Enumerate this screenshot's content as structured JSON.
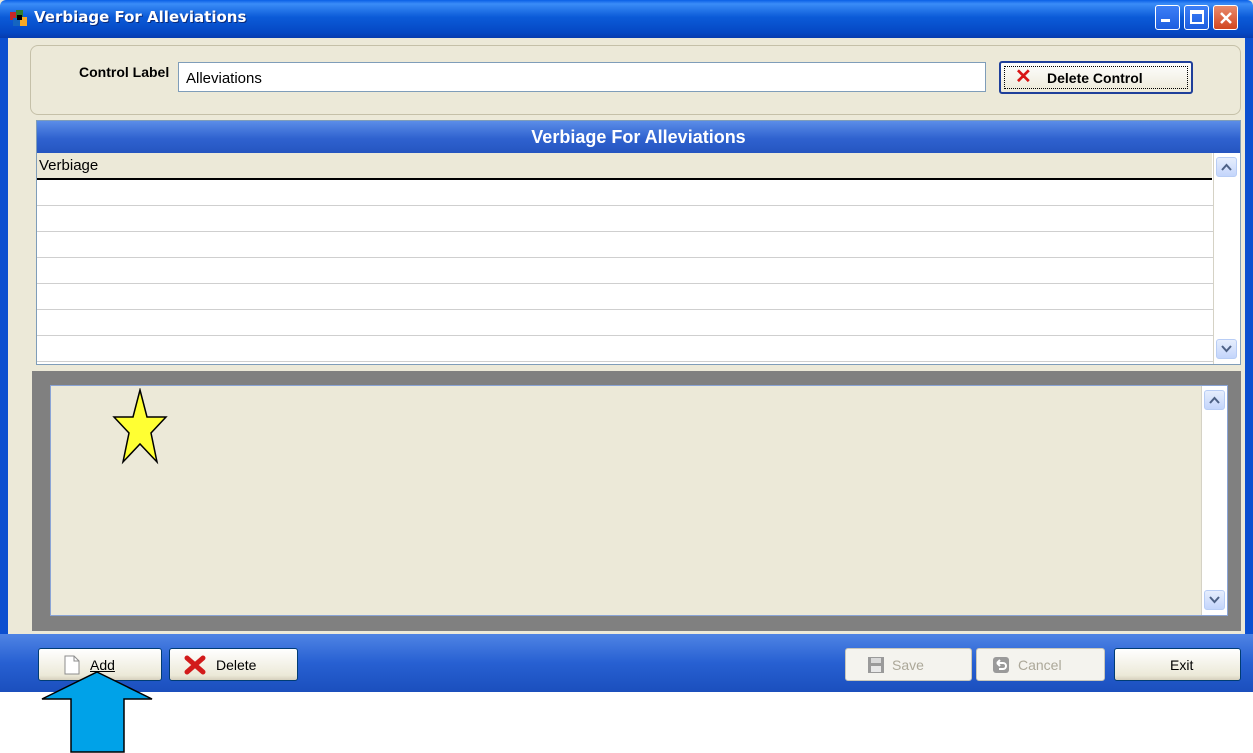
{
  "window": {
    "title": "Verbiage For Alleviations",
    "buttons": [
      "minimize",
      "maximize",
      "close"
    ]
  },
  "control_label": {
    "label": "Control Label",
    "value": "Alleviations",
    "delete_button": "Delete Control"
  },
  "grid": {
    "title": "Verbiage For Alleviations",
    "column_header": "Verbiage",
    "rows": [
      "",
      "",
      "",
      "",
      "",
      "",
      ""
    ]
  },
  "toolbar": {
    "add": "Add",
    "delete": "Delete",
    "save": "Save",
    "cancel": "Cancel",
    "exit": "Exit",
    "save_enabled": false,
    "cancel_enabled": false
  },
  "annotations": {
    "star_color": "#ffff33",
    "arrow_color": "#00a2e8"
  },
  "colors": {
    "titlebar": "#0b5bd8",
    "panel": "#ece9d8",
    "grid_title": "#2f62cf",
    "delete_icon": "#d81515"
  }
}
